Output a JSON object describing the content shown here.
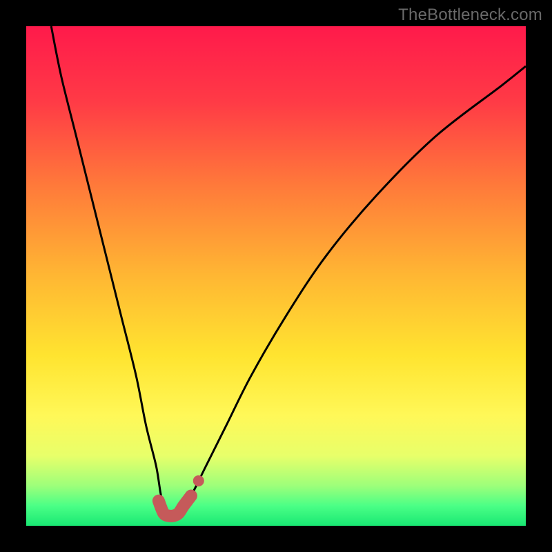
{
  "watermark": "TheBottleneck.com",
  "chart_data": {
    "type": "line",
    "title": "",
    "xlabel": "",
    "ylabel": "",
    "xlim": [
      0,
      100
    ],
    "ylim": [
      0,
      100
    ],
    "grid": false,
    "legend": false,
    "gradient_stops": [
      {
        "offset": 0.0,
        "color": "#ff1a4b"
      },
      {
        "offset": 0.15,
        "color": "#ff3a46"
      },
      {
        "offset": 0.32,
        "color": "#ff7a3a"
      },
      {
        "offset": 0.5,
        "color": "#ffb733"
      },
      {
        "offset": 0.66,
        "color": "#ffe430"
      },
      {
        "offset": 0.78,
        "color": "#fff858"
      },
      {
        "offset": 0.86,
        "color": "#e8ff6a"
      },
      {
        "offset": 0.92,
        "color": "#9dff7a"
      },
      {
        "offset": 0.96,
        "color": "#4bff86"
      },
      {
        "offset": 1.0,
        "color": "#19e873"
      }
    ],
    "series": [
      {
        "name": "bottleneck-curve",
        "stroke": "#000000",
        "stroke_width": 3,
        "x": [
          5,
          7,
          10,
          13,
          16,
          19,
          22,
          24,
          26,
          27,
          28,
          29,
          30,
          31,
          33,
          36,
          40,
          45,
          52,
          60,
          70,
          82,
          95,
          100
        ],
        "y": [
          100,
          90,
          78,
          66,
          54,
          42,
          30,
          20,
          12,
          6,
          3,
          2,
          2,
          3,
          6,
          12,
          20,
          30,
          42,
          54,
          66,
          78,
          88,
          92
        ]
      },
      {
        "name": "bottom-highlight",
        "stroke": "#c55a5a",
        "stroke_width": 18,
        "linecap": "round",
        "x": [
          26.5,
          27.5,
          28.5,
          29.5,
          30.5,
          31.5,
          33.0
        ],
        "y": [
          5.0,
          2.5,
          2.0,
          2.0,
          2.5,
          4.0,
          6.0
        ]
      },
      {
        "name": "bottom-dot",
        "type": "scatter",
        "stroke": "#c55a5a",
        "radius": 8,
        "x": [
          34.5
        ],
        "y": [
          9.0
        ]
      }
    ]
  }
}
